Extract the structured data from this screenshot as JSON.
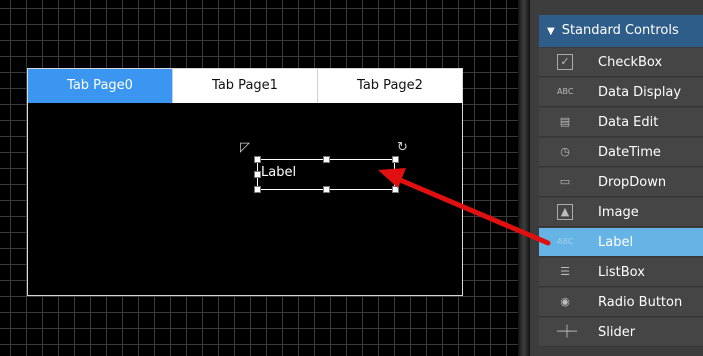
{
  "tabs": [
    {
      "label": "Tab Page0"
    },
    {
      "label": "Tab Page1"
    },
    {
      "label": "Tab Page2"
    }
  ],
  "label_widget": {
    "text": "Label"
  },
  "toolbox": {
    "header": "Standard Controls",
    "items": [
      {
        "label": "CheckBox",
        "icon": "checkbox-icon"
      },
      {
        "label": "Data Display",
        "icon": "data-display-icon"
      },
      {
        "label": "Data Edit",
        "icon": "data-edit-icon"
      },
      {
        "label": "DateTime",
        "icon": "datetime-icon"
      },
      {
        "label": "DropDown",
        "icon": "dropdown-icon"
      },
      {
        "label": "Image",
        "icon": "image-icon"
      },
      {
        "label": "Label",
        "icon": "label-icon"
      },
      {
        "label": "ListBox",
        "icon": "listbox-icon"
      },
      {
        "label": "Radio Button",
        "icon": "radio-button-icon"
      },
      {
        "label": "Slider",
        "icon": "slider-icon"
      }
    ],
    "selected_item": "Label"
  },
  "colors": {
    "active_tab": "#3a96f0",
    "toolbox_header": "#2f5d8a",
    "selected_item": "#66b3e6",
    "arrow": "#e01010"
  }
}
